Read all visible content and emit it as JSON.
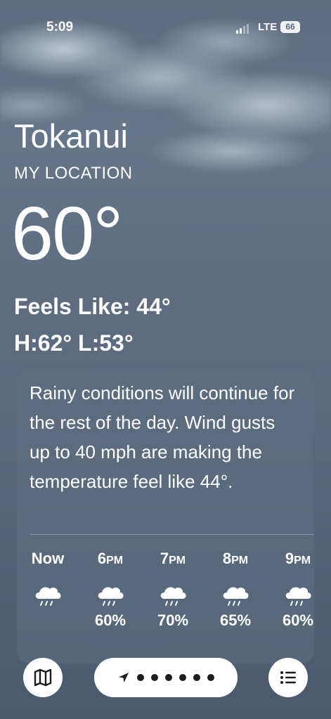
{
  "status_bar": {
    "time": "5:09",
    "network": "LTE",
    "battery": "66"
  },
  "weather": {
    "city": "Tokanui",
    "location_label": "MY LOCATION",
    "temperature": "60°",
    "feels_like": "Feels Like: 44°",
    "high_low": "H:62°  L:53°"
  },
  "forecast": {
    "summary": "Rainy conditions will continue for the rest of the day. Wind gusts up to 40 mph are making the temperature feel like 44°.",
    "hours": [
      {
        "label": "Now",
        "icon": "rain-cloud-icon",
        "precip": ""
      },
      {
        "label": "6PM",
        "icon": "rain-cloud-icon",
        "precip": "60%"
      },
      {
        "label": "7PM",
        "icon": "rain-cloud-icon",
        "precip": "70%"
      },
      {
        "label": "8PM",
        "icon": "rain-cloud-icon",
        "precip": "65%"
      },
      {
        "label": "9PM",
        "icon": "rain-cloud-icon",
        "precip": "60%"
      }
    ]
  },
  "toolbar": {
    "map_icon": "map-icon",
    "location_arrow_icon": "location-arrow-icon",
    "page_dots": 6,
    "list_icon": "list-icon"
  },
  "colors": {
    "background": "#5d6c80",
    "card": "#5f7084",
    "foreground": "#ffffff"
  }
}
